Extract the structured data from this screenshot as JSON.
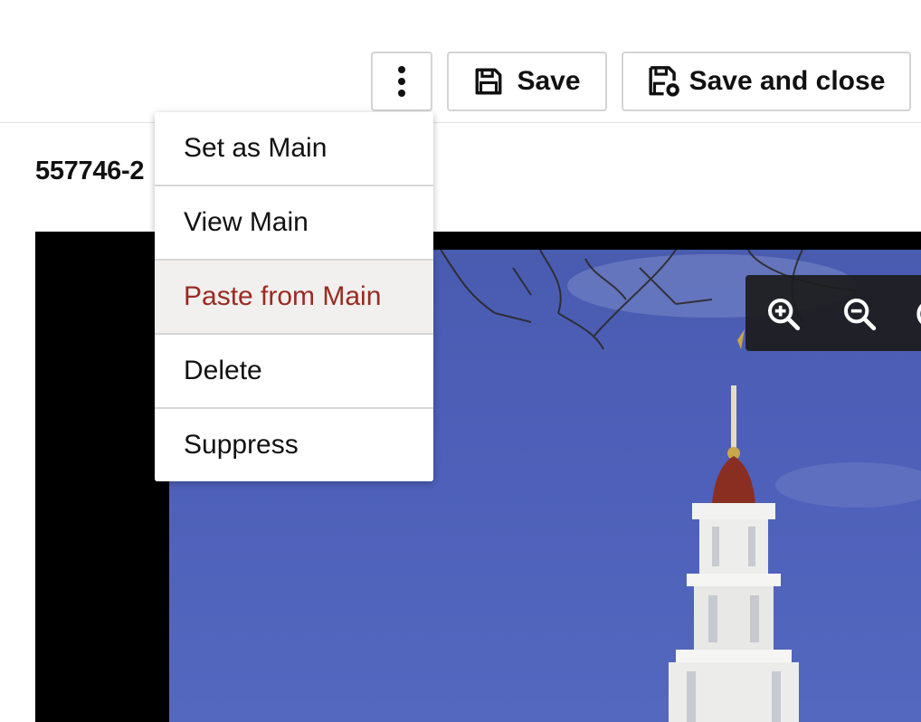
{
  "toolbar": {
    "more_icon": "kebab-vertical-icon",
    "save_icon": "floppy-disk-icon",
    "save_label": "Save",
    "save_close_icon": "floppy-disk-close-icon",
    "save_close_label": "Save and close"
  },
  "asset": {
    "title": "557746-2"
  },
  "viewer": {
    "zoom_in_icon": "zoom-in-icon",
    "zoom_out_icon": "zoom-out-icon"
  },
  "menu": {
    "items": [
      {
        "label": "Set as Main"
      },
      {
        "label": "View Main"
      },
      {
        "label": "Paste from Main",
        "state": "hovered"
      },
      {
        "label": "Delete"
      },
      {
        "label": "Suppress"
      }
    ]
  },
  "colors": {
    "accent_text": "#9a2a22",
    "hover_bg": "#f1f0ee",
    "border": "#d4d4d4",
    "viewer_bg": "#000000",
    "sky": "#4d5fb8"
  }
}
